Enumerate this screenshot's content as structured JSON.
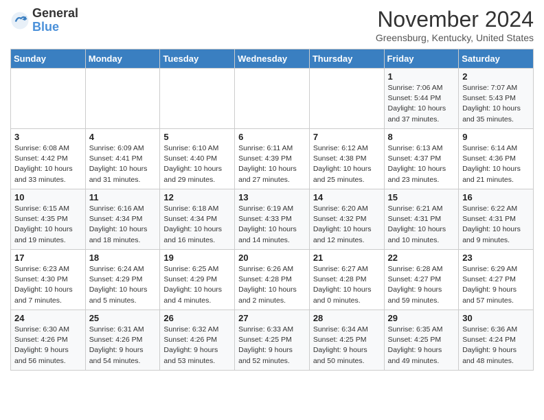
{
  "header": {
    "logo_general": "General",
    "logo_blue": "Blue",
    "month_title": "November 2024",
    "location": "Greensburg, Kentucky, United States"
  },
  "weekdays": [
    "Sunday",
    "Monday",
    "Tuesday",
    "Wednesday",
    "Thursday",
    "Friday",
    "Saturday"
  ],
  "weeks": [
    [
      {
        "day": "",
        "info": ""
      },
      {
        "day": "",
        "info": ""
      },
      {
        "day": "",
        "info": ""
      },
      {
        "day": "",
        "info": ""
      },
      {
        "day": "",
        "info": ""
      },
      {
        "day": "1",
        "info": "Sunrise: 7:06 AM\nSunset: 5:44 PM\nDaylight: 10 hours and 37 minutes."
      },
      {
        "day": "2",
        "info": "Sunrise: 7:07 AM\nSunset: 5:43 PM\nDaylight: 10 hours and 35 minutes."
      }
    ],
    [
      {
        "day": "3",
        "info": "Sunrise: 6:08 AM\nSunset: 4:42 PM\nDaylight: 10 hours and 33 minutes."
      },
      {
        "day": "4",
        "info": "Sunrise: 6:09 AM\nSunset: 4:41 PM\nDaylight: 10 hours and 31 minutes."
      },
      {
        "day": "5",
        "info": "Sunrise: 6:10 AM\nSunset: 4:40 PM\nDaylight: 10 hours and 29 minutes."
      },
      {
        "day": "6",
        "info": "Sunrise: 6:11 AM\nSunset: 4:39 PM\nDaylight: 10 hours and 27 minutes."
      },
      {
        "day": "7",
        "info": "Sunrise: 6:12 AM\nSunset: 4:38 PM\nDaylight: 10 hours and 25 minutes."
      },
      {
        "day": "8",
        "info": "Sunrise: 6:13 AM\nSunset: 4:37 PM\nDaylight: 10 hours and 23 minutes."
      },
      {
        "day": "9",
        "info": "Sunrise: 6:14 AM\nSunset: 4:36 PM\nDaylight: 10 hours and 21 minutes."
      }
    ],
    [
      {
        "day": "10",
        "info": "Sunrise: 6:15 AM\nSunset: 4:35 PM\nDaylight: 10 hours and 19 minutes."
      },
      {
        "day": "11",
        "info": "Sunrise: 6:16 AM\nSunset: 4:34 PM\nDaylight: 10 hours and 18 minutes."
      },
      {
        "day": "12",
        "info": "Sunrise: 6:18 AM\nSunset: 4:34 PM\nDaylight: 10 hours and 16 minutes."
      },
      {
        "day": "13",
        "info": "Sunrise: 6:19 AM\nSunset: 4:33 PM\nDaylight: 10 hours and 14 minutes."
      },
      {
        "day": "14",
        "info": "Sunrise: 6:20 AM\nSunset: 4:32 PM\nDaylight: 10 hours and 12 minutes."
      },
      {
        "day": "15",
        "info": "Sunrise: 6:21 AM\nSunset: 4:31 PM\nDaylight: 10 hours and 10 minutes."
      },
      {
        "day": "16",
        "info": "Sunrise: 6:22 AM\nSunset: 4:31 PM\nDaylight: 10 hours and 9 minutes."
      }
    ],
    [
      {
        "day": "17",
        "info": "Sunrise: 6:23 AM\nSunset: 4:30 PM\nDaylight: 10 hours and 7 minutes."
      },
      {
        "day": "18",
        "info": "Sunrise: 6:24 AM\nSunset: 4:29 PM\nDaylight: 10 hours and 5 minutes."
      },
      {
        "day": "19",
        "info": "Sunrise: 6:25 AM\nSunset: 4:29 PM\nDaylight: 10 hours and 4 minutes."
      },
      {
        "day": "20",
        "info": "Sunrise: 6:26 AM\nSunset: 4:28 PM\nDaylight: 10 hours and 2 minutes."
      },
      {
        "day": "21",
        "info": "Sunrise: 6:27 AM\nSunset: 4:28 PM\nDaylight: 10 hours and 0 minutes."
      },
      {
        "day": "22",
        "info": "Sunrise: 6:28 AM\nSunset: 4:27 PM\nDaylight: 9 hours and 59 minutes."
      },
      {
        "day": "23",
        "info": "Sunrise: 6:29 AM\nSunset: 4:27 PM\nDaylight: 9 hours and 57 minutes."
      }
    ],
    [
      {
        "day": "24",
        "info": "Sunrise: 6:30 AM\nSunset: 4:26 PM\nDaylight: 9 hours and 56 minutes."
      },
      {
        "day": "25",
        "info": "Sunrise: 6:31 AM\nSunset: 4:26 PM\nDaylight: 9 hours and 54 minutes."
      },
      {
        "day": "26",
        "info": "Sunrise: 6:32 AM\nSunset: 4:26 PM\nDaylight: 9 hours and 53 minutes."
      },
      {
        "day": "27",
        "info": "Sunrise: 6:33 AM\nSunset: 4:25 PM\nDaylight: 9 hours and 52 minutes."
      },
      {
        "day": "28",
        "info": "Sunrise: 6:34 AM\nSunset: 4:25 PM\nDaylight: 9 hours and 50 minutes."
      },
      {
        "day": "29",
        "info": "Sunrise: 6:35 AM\nSunset: 4:25 PM\nDaylight: 9 hours and 49 minutes."
      },
      {
        "day": "30",
        "info": "Sunrise: 6:36 AM\nSunset: 4:24 PM\nDaylight: 9 hours and 48 minutes."
      }
    ]
  ]
}
